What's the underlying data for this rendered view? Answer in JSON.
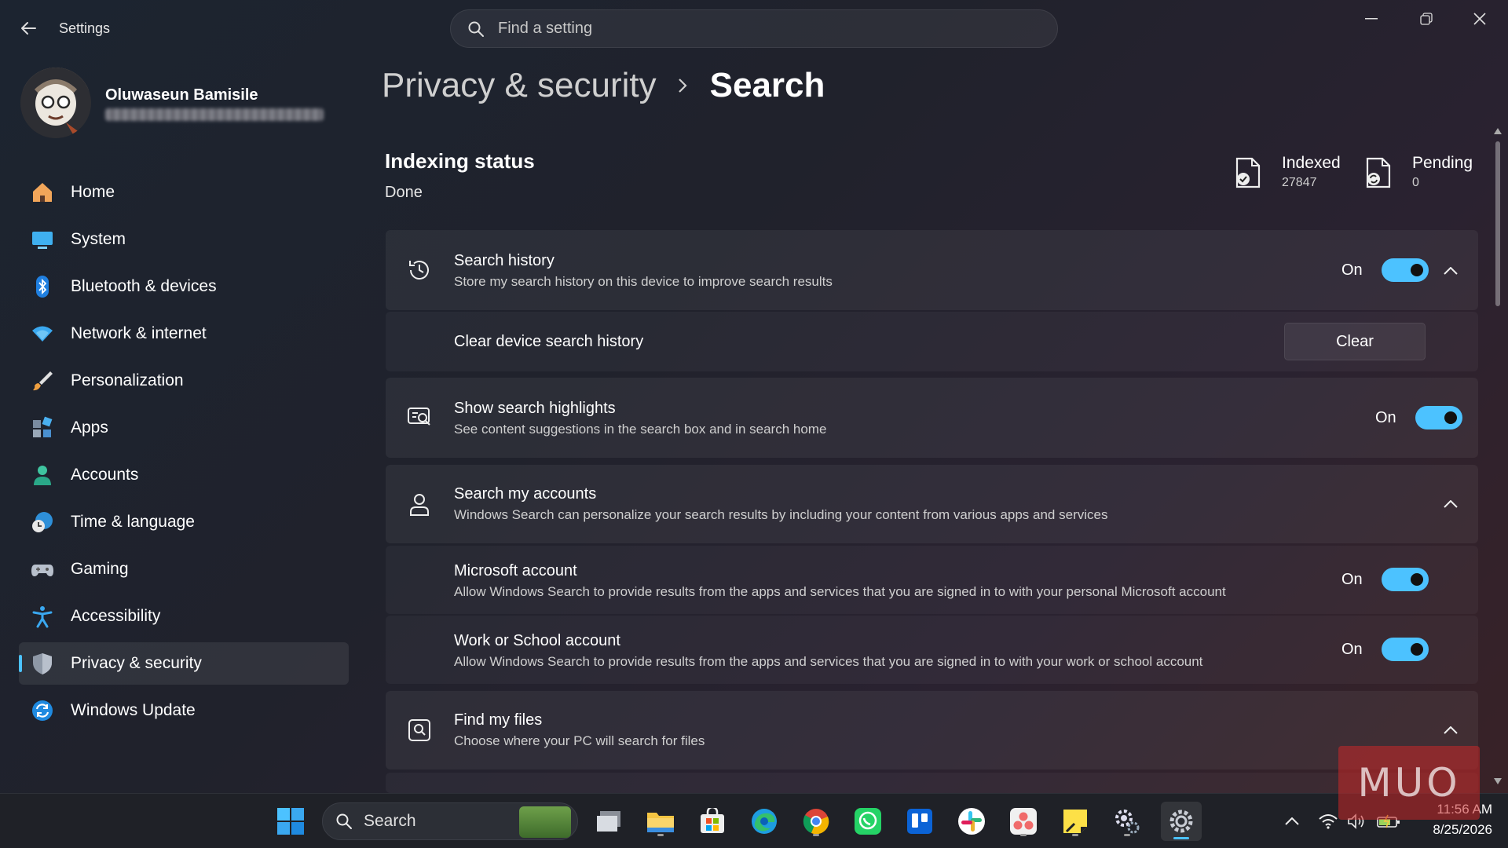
{
  "app": {
    "title": "Settings"
  },
  "search": {
    "placeholder": "Find a setting"
  },
  "profile": {
    "name": "Oluwaseun Bamisile"
  },
  "sidebar": {
    "items": [
      {
        "label": "Home",
        "icon": "home-icon"
      },
      {
        "label": "System",
        "icon": "system-icon"
      },
      {
        "label": "Bluetooth & devices",
        "icon": "bluetooth-icon"
      },
      {
        "label": "Network & internet",
        "icon": "wifi-icon"
      },
      {
        "label": "Personalization",
        "icon": "brush-icon"
      },
      {
        "label": "Apps",
        "icon": "apps-icon"
      },
      {
        "label": "Accounts",
        "icon": "person-icon"
      },
      {
        "label": "Time & language",
        "icon": "clock-globe-icon"
      },
      {
        "label": "Gaming",
        "icon": "gamepad-icon"
      },
      {
        "label": "Accessibility",
        "icon": "accessibility-icon"
      },
      {
        "label": "Privacy & security",
        "icon": "shield-icon"
      },
      {
        "label": "Windows Update",
        "icon": "update-icon"
      }
    ],
    "active": "Privacy & security"
  },
  "breadcrumb": {
    "parent": "Privacy & security",
    "current": "Search"
  },
  "indexing": {
    "title": "Indexing status",
    "status": "Done",
    "indexed_label": "Indexed",
    "indexed_value": "27847",
    "pending_label": "Pending",
    "pending_value": "0"
  },
  "settings": {
    "search_history": {
      "title": "Search history",
      "desc": "Store my search history on this device to improve search results",
      "state": "On"
    },
    "clear_history": {
      "title": "Clear device search history",
      "button": "Clear"
    },
    "highlights": {
      "title": "Show search highlights",
      "desc": "See content suggestions in the search box and in search home",
      "state": "On"
    },
    "accounts": {
      "title": "Search my accounts",
      "desc": "Windows Search can personalize your search results by including your content from various apps and services"
    },
    "microsoft_account": {
      "title": "Microsoft account",
      "desc": "Allow Windows Search to provide results from the apps and services that you are signed in to with your personal Microsoft account",
      "state": "On"
    },
    "work_account": {
      "title": "Work or School account",
      "desc": "Allow Windows Search to provide results from the apps and services that you are signed in to with your work or school account",
      "state": "On"
    },
    "find_files": {
      "title": "Find my files",
      "desc": "Choose where your PC will search for files"
    }
  },
  "taskbar": {
    "search_label": "Search",
    "time": "11:56 AM",
    "date": "8/25/2026"
  },
  "watermark": {
    "text": "MUO"
  },
  "colors": {
    "accent": "#4cc2ff",
    "toggle_knob": "#111111"
  }
}
